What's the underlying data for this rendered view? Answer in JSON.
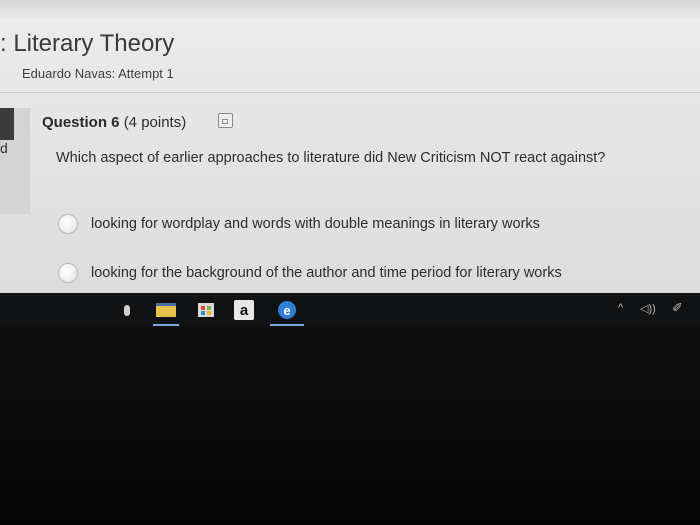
{
  "page": {
    "title": ": Literary Theory",
    "attempt": "Eduardo Navas: Attempt 1",
    "left_rail_mark": "d"
  },
  "question": {
    "title": "Question 6",
    "points": "(4 points)",
    "text": "Which aspect of earlier approaches to literature did New Criticism NOT react against?",
    "save_icon": "save-icon",
    "options": [
      {
        "label": "looking for wordplay and words with double meanings in literary works",
        "selected": false
      },
      {
        "label": "looking for the background of the author and time period for literary works",
        "selected": false
      }
    ]
  },
  "taskbar": {
    "icons": [
      "microphone-icon",
      "file-explorer-icon",
      "store-icon",
      "amazon-icon",
      "edge-icon"
    ],
    "amazon_glyph": "a",
    "edge_glyph": "e",
    "tray": {
      "chevron": "^",
      "volume": "◁))",
      "pen": "✐"
    }
  },
  "colors": {
    "taskbar_bg": "#111214",
    "page_bg": "#e6e6e6",
    "active_underline": "#7aa7e0"
  }
}
